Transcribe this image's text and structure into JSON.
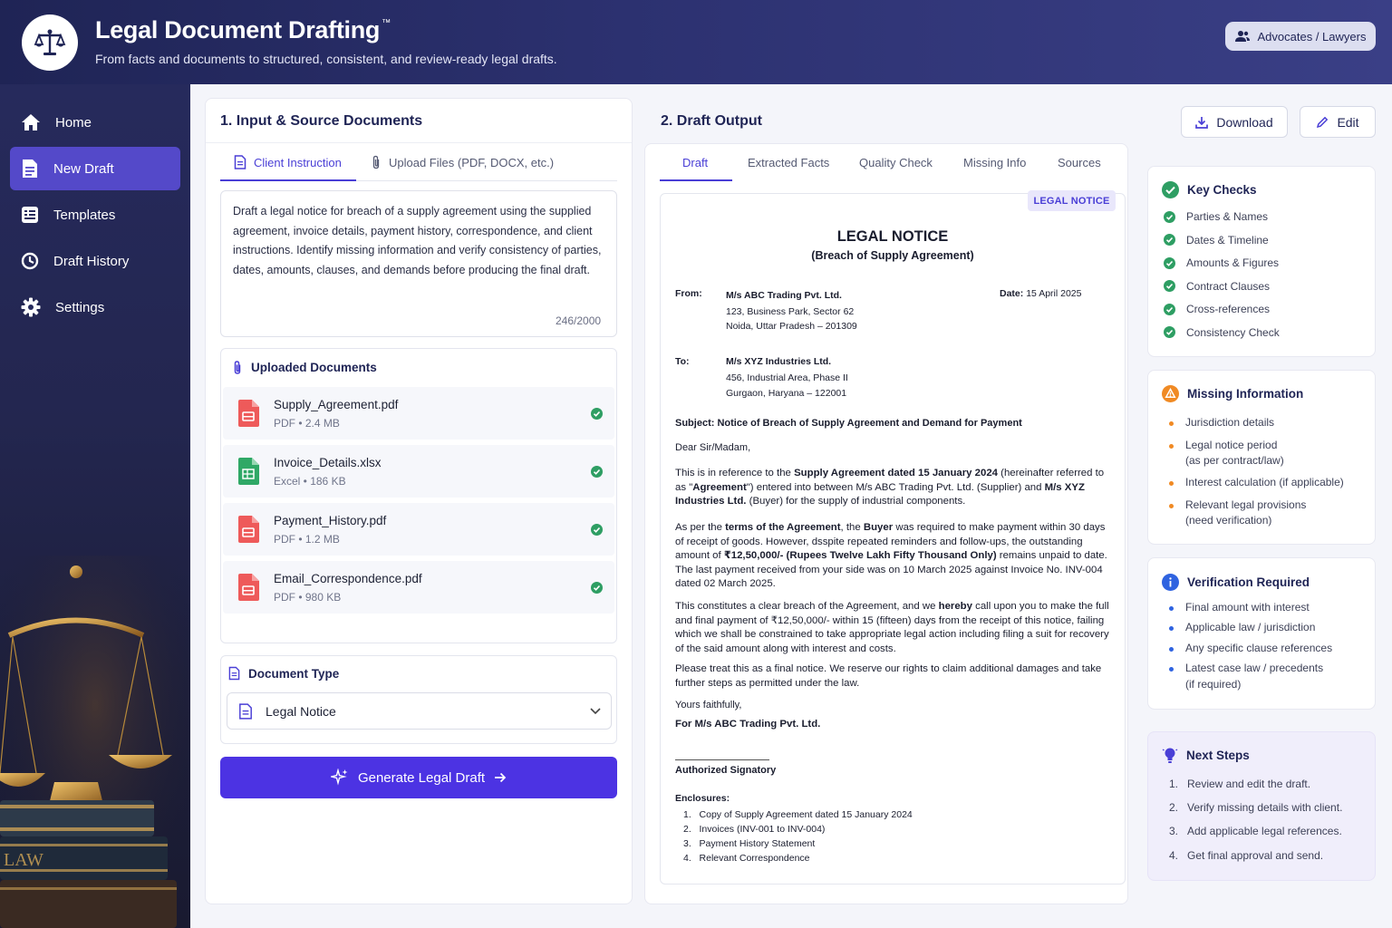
{
  "app": {
    "title": "Legal Document Drafting",
    "trademark": "™",
    "subtitle": "From facts and documents to structured, consistent, and review-ready legal drafts.",
    "role_button": "Advocates / Lawyers"
  },
  "sidebar": {
    "items": [
      {
        "label": "Home",
        "icon": "home-icon"
      },
      {
        "label": "New Draft",
        "icon": "document-icon"
      },
      {
        "label": "Templates",
        "icon": "templates-icon"
      },
      {
        "label": "Draft History",
        "icon": "clock-icon"
      },
      {
        "label": "Settings",
        "icon": "gear-icon"
      }
    ],
    "active": "New Draft"
  },
  "input": {
    "title": "1.  Input & Source Documents",
    "tabs": [
      "Client Instruction",
      "Upload Files (PDF, DOCX, etc.)"
    ],
    "instruction": "Draft a legal notice for breach of a supply agreement using the supplied agreement, invoice details, payment history, correspondence, and client instructions. Identify missing information and verify consistency of parties, dates, amounts, clauses, and demands before producing the final draft.",
    "counter": "246/2000",
    "uploaded_title": "Uploaded Documents",
    "files": [
      {
        "name": "Supply_Agreement.pdf",
        "meta": "PDF • 2.4 MB",
        "type": "pdf"
      },
      {
        "name": "Invoice_Details.xlsx",
        "meta": "Excel • 186 KB",
        "type": "excel"
      },
      {
        "name": "Payment_History.pdf",
        "meta": "PDF • 1.2 MB",
        "type": "pdf"
      },
      {
        "name": "Email_Correspondence.pdf",
        "meta": "PDF • 980 KB",
        "type": "pdf"
      }
    ],
    "doctype_title": "Document Type",
    "doctype_value": "Legal Notice",
    "generate_label": "Generate Legal Draft"
  },
  "output": {
    "title": "2.  Draft Output",
    "download_label": "Download",
    "edit_label": "Edit",
    "tabs": [
      "Draft",
      "Extracted Facts",
      "Quality Check",
      "Missing Info",
      "Sources"
    ],
    "badge": "LEGAL NOTICE",
    "doc": {
      "heading": "LEGAL NOTICE",
      "subheading": "(Breach of Supply Agreement)",
      "from_label": "From:",
      "from_lines": [
        "M/s ABC Trading Pvt. Ltd.",
        "123, Business Park, Sector 62",
        "Noida, Uttar Pradesh – 201309"
      ],
      "date_label": "Date:",
      "date_value": "15 April 2025",
      "to_label": "To:",
      "to_lines": [
        "M/s XYZ Industries Ltd.",
        "456, Industrial Area, Phase II",
        "Gurgaon, Haryana – 122001"
      ],
      "subject": "Subject: Notice of Breach of Supply Agreement and Demand for Payment",
      "salutation": "Dear Sir/Madam,",
      "p1": {
        "a": "This is in reference to the ",
        "b": "Supply Agreement dated 15 January 2024",
        "c": " (hereinafter referred to as \"",
        "d": "Agreement",
        "e": "\") entered into between M/s ABC Trading Pvt. Ltd. (Supplier) and ",
        "f": "M/s XYZ Industries Ltd.",
        "g": " (Buyer) for the supply of industrial components."
      },
      "p2": {
        "a": "As per the ",
        "b": "terms of the Agreement",
        "c": ", the ",
        "d": "Buyer",
        "e": " was required to make payment within 30 days of receipt of goods. However, dsspite repeated reminders and follow-ups, the outstanding amount of ",
        "f": "₹12,50,000/- (Rupees Twelve Lakh Fifty Thousand Only)",
        "g": " remains unpaid to date. The last payment received from your side was on 10 March 2025 against Invoice No. INV-004 dated 02 March 2025."
      },
      "p3": {
        "a": "This constitutes a clear breach of the Agreement, and we ",
        "b": "hereby",
        "c": " call upon you to make the full and final payment of ₹12,50,000/- within 15 (fifteen) days from the receipt of this notice, failing which we shall be constrained to take appropriate legal action including filing a suit for recovery of the said amount along with interest and costs."
      },
      "p4": "Please treat this as a final notice. We reserve our rights to claim additional damages and take further steps as permitted under the law.",
      "closing": "Yours faithfully,",
      "closing_firm": "For M/s ABC Trading Pvt. Ltd.",
      "signatory": "Authorized Signatory",
      "enclosures_label": "Enclosures:",
      "enclosures": [
        "Copy of Supply Agreement dated 15 January 2024",
        "Invoices (INV-001 to INV-004)",
        "Payment History Statement",
        "Relevant Correspondence"
      ]
    }
  },
  "key_checks": {
    "title": "Key Checks",
    "items": [
      "Parties & Names",
      "Dates & Timeline",
      "Amounts & Figures",
      "Contract Clauses",
      "Cross-references",
      "Consistency Check"
    ]
  },
  "missing": {
    "title": "Missing Information",
    "items": [
      "Jurisdiction details",
      "Legal notice period",
      "(as per contract/law)",
      "Interest calculation (if applicable)",
      "Relevant legal provisions",
      "(need verification)"
    ]
  },
  "verification": {
    "title": "Verification Required",
    "items": [
      "Final amount with interest",
      "Applicable law / jurisdiction",
      "Any specific clause references",
      "Latest case law / precedents",
      "(if required)"
    ]
  },
  "next_steps": {
    "title": "Next Steps",
    "items": [
      "Review and edit the draft.",
      "Verify missing details with client.",
      "Add applicable legal references.",
      "Get final approval and send."
    ],
    "numbers": [
      "1.",
      "2.",
      "3.",
      "4."
    ]
  },
  "colors": {
    "accent": "#4a3fd6",
    "success": "#2e9e63",
    "warning": "#f08a24",
    "info": "#2f63e0",
    "header": "#2c3170"
  }
}
